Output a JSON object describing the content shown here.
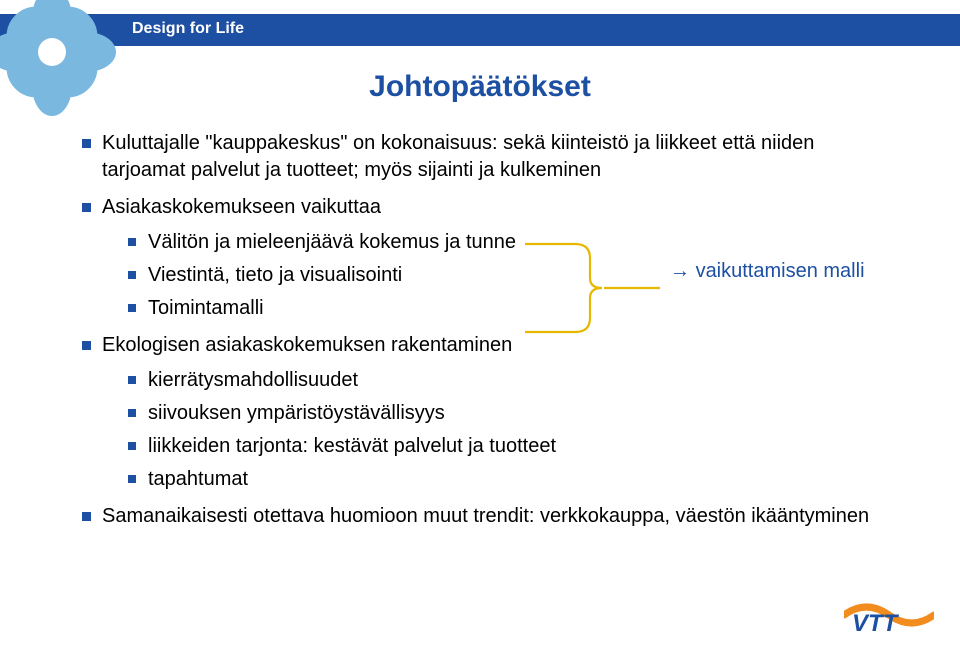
{
  "header": {
    "label": "Design for Life"
  },
  "title": "Johtopäätökset",
  "callout": {
    "arrow": "→",
    "text": "vaikuttamisen malli"
  },
  "bullets": [
    {
      "text": "Kuluttajalle \"kauppakeskus\" on kokonaisuus: sekä kiinteistö ja liikkeet että niiden tarjoamat palvelut ja tuotteet; myös sijainti ja kulkeminen",
      "children": []
    },
    {
      "text": "Asiakaskokemukseen vaikuttaa",
      "children": [
        {
          "text": "Välitön ja mieleenjäävä kokemus ja tunne",
          "children": []
        },
        {
          "text": "Viestintä, tieto ja visualisointi",
          "children": []
        },
        {
          "text": "Toimintamalli",
          "children": []
        }
      ]
    },
    {
      "text": "Ekologisen asiakaskokemuksen rakentaminen",
      "children": [
        {
          "text": "kierrätysmahdollisuudet",
          "children": []
        },
        {
          "text": "siivouksen ympäristöystävällisyys",
          "children": []
        },
        {
          "text": "liikkeiden tarjonta: kestävät palvelut ja tuotteet",
          "children": []
        },
        {
          "text": "tapahtumat",
          "children": []
        }
      ]
    },
    {
      "text": "Samanaikaisesti otettava huomioon muut trendit: verkkokauppa, väestön ikääntyminen",
      "children": []
    }
  ],
  "logo": {
    "text": "VTT"
  }
}
